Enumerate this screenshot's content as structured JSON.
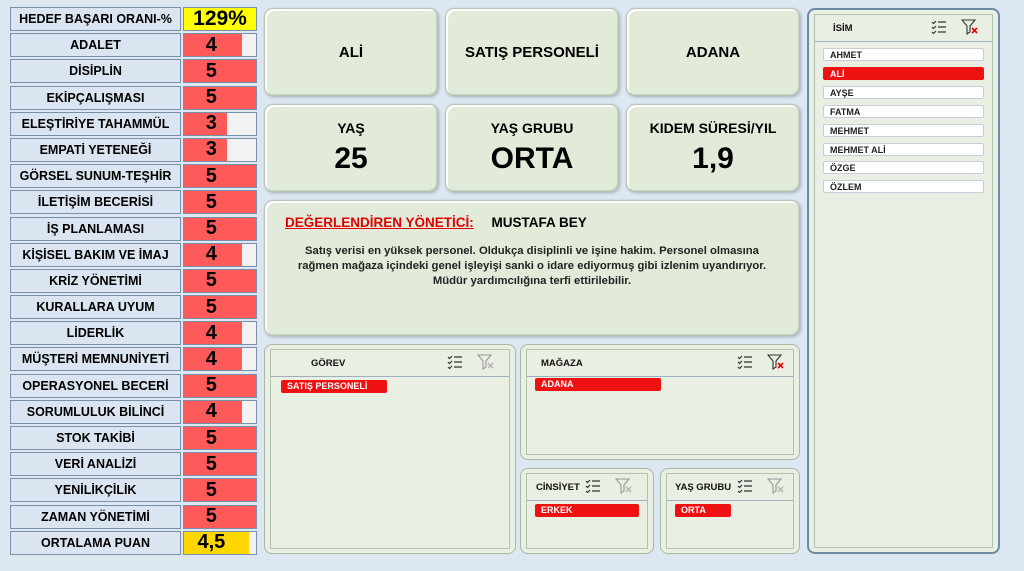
{
  "score_table": {
    "header": {
      "label": "HEDEF BAŞARI ORANI-%",
      "value": "129%"
    },
    "rows": [
      {
        "label": "ADALET",
        "value": "4",
        "score": 4
      },
      {
        "label": "DİSİPLİN",
        "value": "5",
        "score": 5
      },
      {
        "label": "EKİPÇALIŞMASI",
        "value": "5",
        "score": 5
      },
      {
        "label": "ELEŞTİRİYE TAHAMMÜL",
        "value": "3",
        "score": 3
      },
      {
        "label": "EMPATİ YETENEĞİ",
        "value": "3",
        "score": 3
      },
      {
        "label": "GÖRSEL SUNUM-TEŞHİR",
        "value": "5",
        "score": 5
      },
      {
        "label": "İLETİŞİM BECERİSİ",
        "value": "5",
        "score": 5
      },
      {
        "label": "İŞ PLANLAMASI",
        "value": "5",
        "score": 5
      },
      {
        "label": "KİŞİSEL BAKIM VE İMAJ",
        "value": "4",
        "score": 4
      },
      {
        "label": "KRİZ YÖNETİMİ",
        "value": "5",
        "score": 5
      },
      {
        "label": "KURALLARA UYUM",
        "value": "5",
        "score": 5
      },
      {
        "label": "LİDERLİK",
        "value": "4",
        "score": 4
      },
      {
        "label": "MÜŞTERİ MEMNUNİYETİ",
        "value": "4",
        "score": 4
      },
      {
        "label": "OPERASYONEL BECERİ",
        "value": "5",
        "score": 5
      },
      {
        "label": "SORUMLULUK BİLİNCİ",
        "value": "4",
        "score": 4
      },
      {
        "label": "STOK TAKİBİ",
        "value": "5",
        "score": 5
      },
      {
        "label": "VERİ ANALİZİ",
        "value": "5",
        "score": 5
      },
      {
        "label": "YENİLİKÇİLİK",
        "value": "5",
        "score": 5
      },
      {
        "label": "ZAMAN YÖNETİMİ",
        "value": "5",
        "score": 5
      }
    ],
    "average": {
      "label": "ORTALAMA PUAN",
      "value": "4,5",
      "score": 4.5
    },
    "max_score": 5
  },
  "info": {
    "name": "ALİ",
    "position": "SATIŞ PERSONELİ",
    "city": "ADANA",
    "age_title": "YAŞ",
    "age_value": "25",
    "age_group_title": "YAŞ GRUBU",
    "age_group_value": "ORTA",
    "seniority_title": "KIDEM SÜRESİ/YIL",
    "seniority_value": "1,9"
  },
  "evaluation": {
    "manager_label": "DEĞERLENDİREN YÖNETİCİ:",
    "manager_name": "MUSTAFA  BEY",
    "comment": "Satış verisi en yüksek personel. Oldukça disiplinli ve işine hakim. Personel olmasına rağmen mağaza içindeki genel işleyişi sanki o idare ediyormuş gibi izlenim uyandırıyor. Müdür yardımcılığına terfi ettirilebilir."
  },
  "slicers": {
    "isim": {
      "title": "İSİM",
      "items": [
        "AHMET",
        "ALİ",
        "AYŞE",
        "FATMA",
        "MEHMET",
        "MEHMET ALİ",
        "ÖZGE",
        "ÖZLEM"
      ],
      "selected": "ALİ"
    },
    "gorev": {
      "title": "GÖREV",
      "selected": "SATIŞ PERSONELİ"
    },
    "magaza": {
      "title": "MAĞAZA",
      "selected": "ADANA"
    },
    "cinsiyet": {
      "title": "CİNSİYET",
      "selected": "ERKEK"
    },
    "yas_grubu": {
      "title": "YAŞ GRUBU",
      "selected": "ORTA"
    }
  },
  "colors": {
    "score_fill": "#ff5a5a",
    "target_highlight": "#ffff00",
    "average_fill": "#ffd700",
    "slicer_selected": "#ee1111",
    "card_bg": "#e2ebd9"
  }
}
